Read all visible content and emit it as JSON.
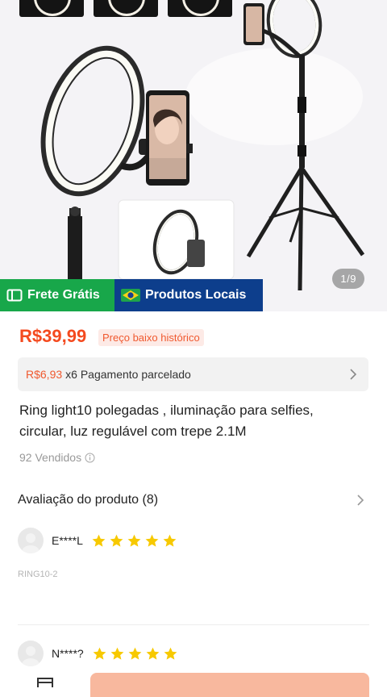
{
  "gallery": {
    "counter": "1/9",
    "badges": {
      "free_shipping": "Frete Grátis",
      "local_products": "Produtos Locais"
    }
  },
  "price": {
    "value": "R$39,99",
    "tag": "Preço baixo histórico"
  },
  "installment": {
    "amount": "R$6,93",
    "text": "x6 Pagamento parcelado"
  },
  "product": {
    "title": "Ring light10 polegadas , iluminação para selfies, circular, luz regulável com trepe 2.1M",
    "sold": "92 Vendidos"
  },
  "reviews": {
    "heading": "Avaliação do produto (8)",
    "items": [
      {
        "name": "E****L",
        "stars": 5,
        "variant": "RING10-2"
      },
      {
        "name": "N****?",
        "stars": 5
      }
    ]
  },
  "colors": {
    "price": "#f44a1f",
    "free_shipping_badge": "#18a74a",
    "local_badge": "#0d3e8c",
    "star": "#f7c900",
    "cart_button": "#f8b89e"
  },
  "icons": {
    "free_shipping": "ticket-icon",
    "local_products": "brazil-flag-icon",
    "sold_info": "info-icon",
    "chevron": "chevron-right-icon",
    "star": "star-icon",
    "store": "store-icon"
  }
}
